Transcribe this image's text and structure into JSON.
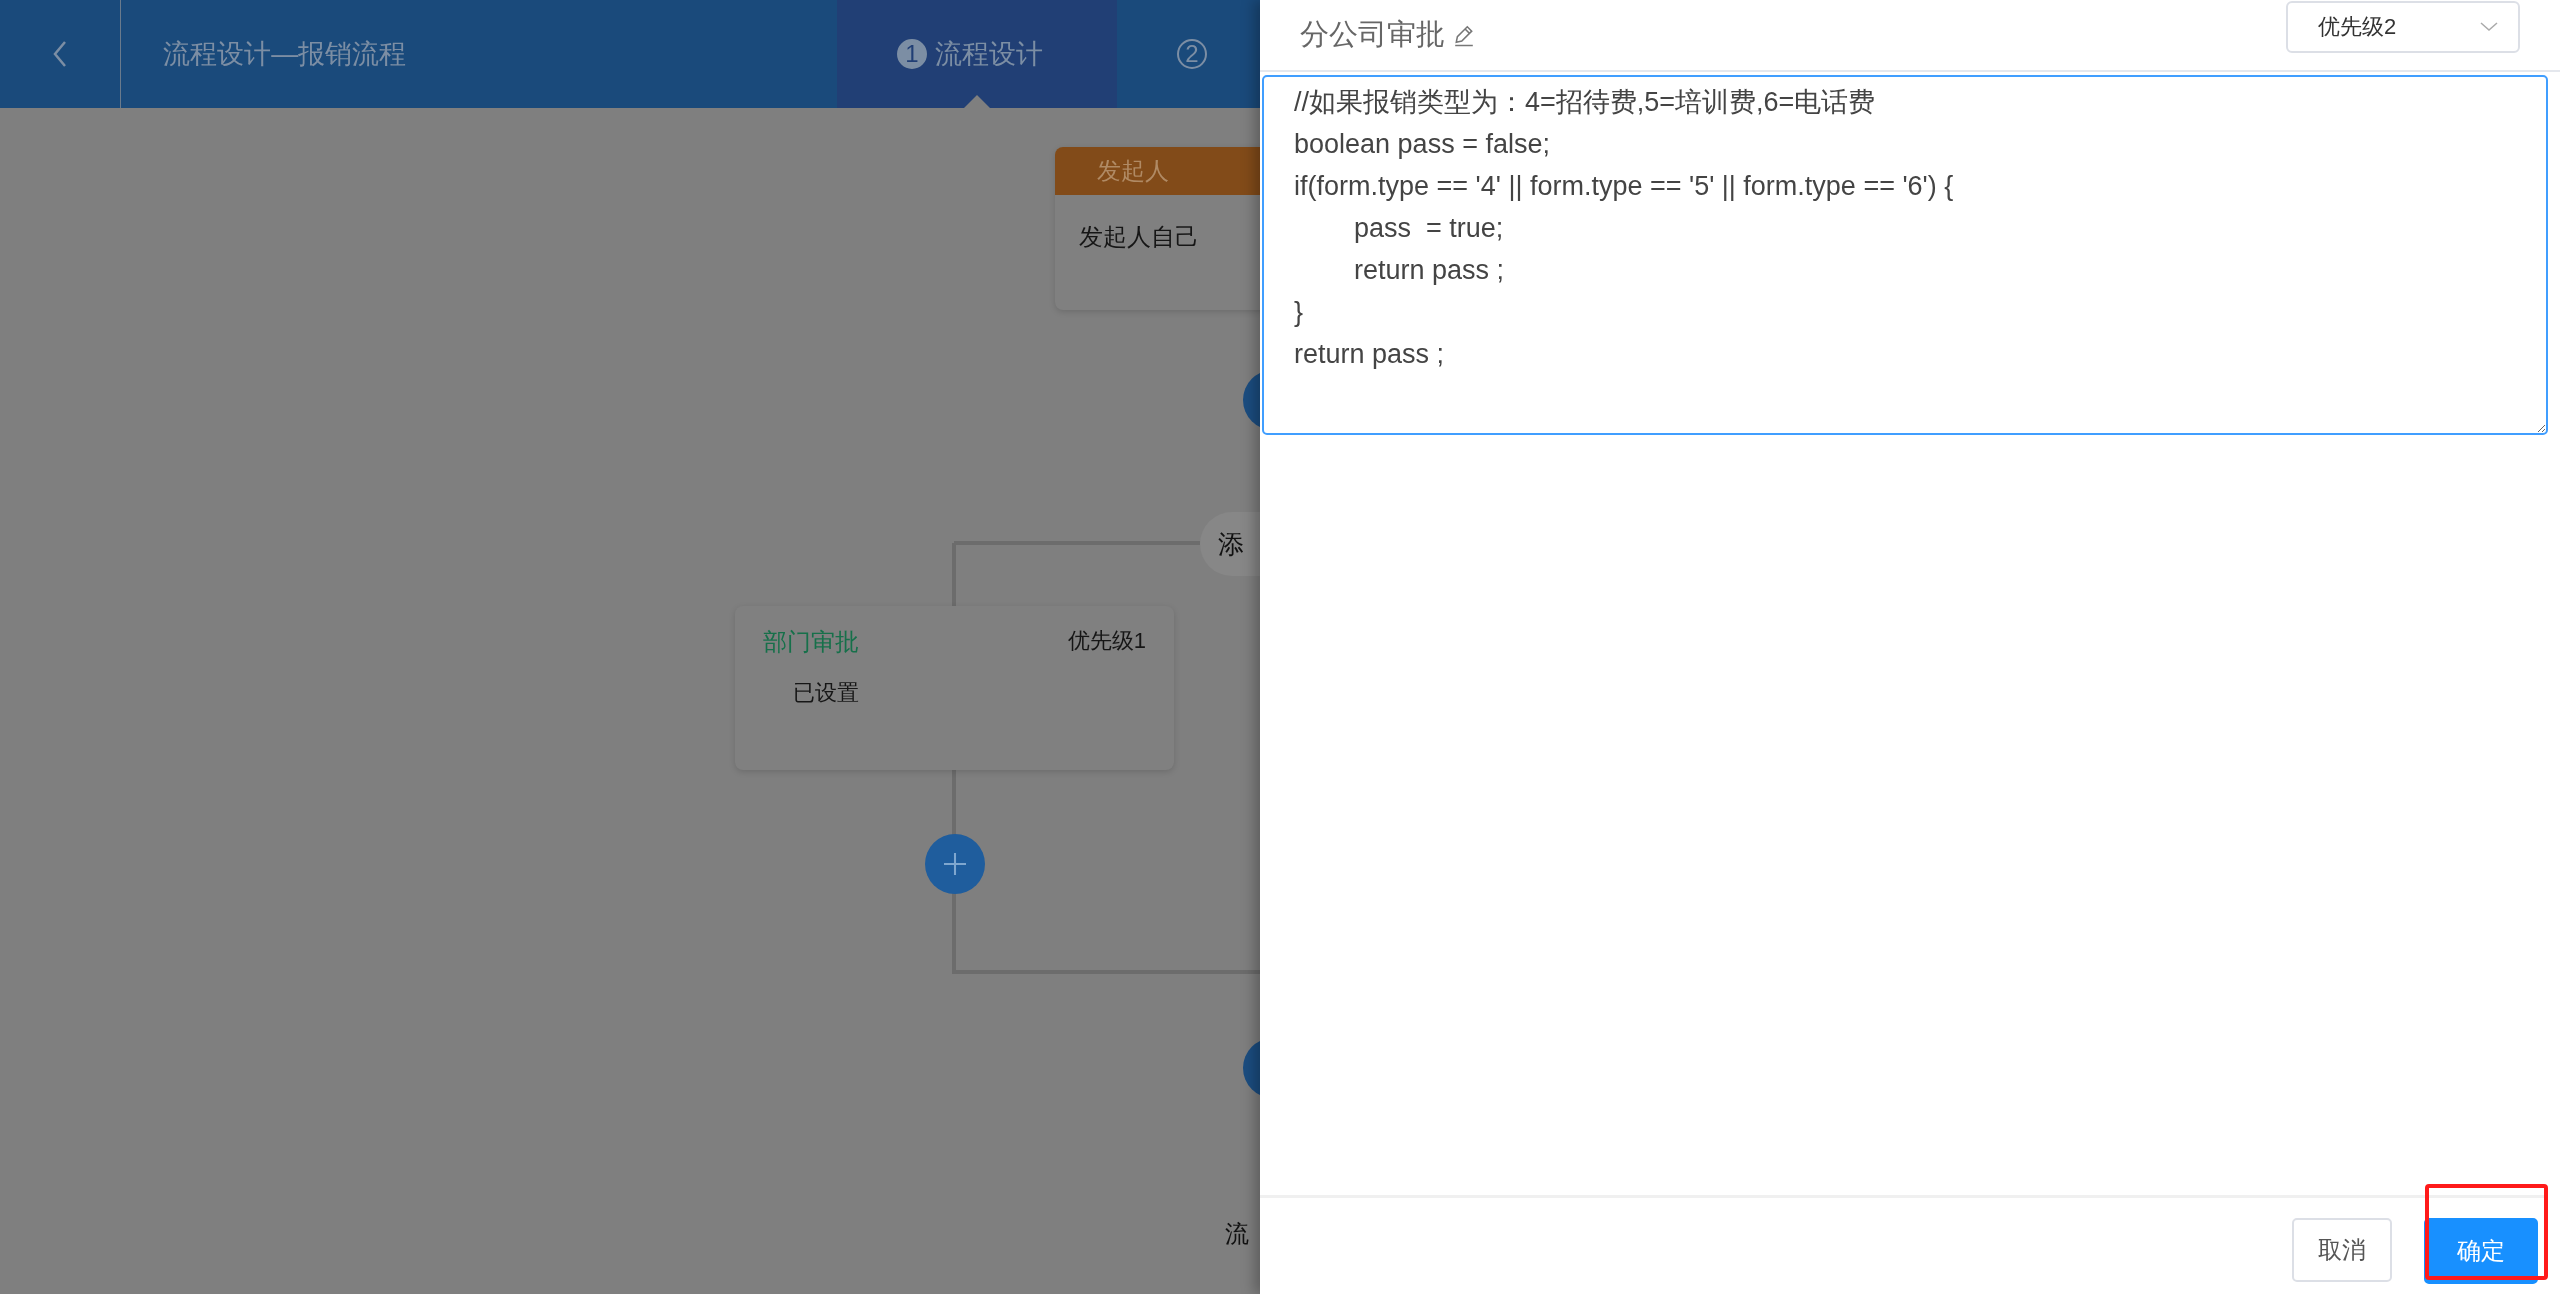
{
  "header": {
    "title": "流程设计—报销流程",
    "steps": [
      {
        "number": "1",
        "label": "流程设计",
        "selected": true
      },
      {
        "number": "2",
        "selected": false
      }
    ]
  },
  "flow": {
    "start_node": {
      "title": "发起人",
      "body": "发起人自己"
    },
    "add_condition": {
      "label": "添"
    },
    "branch_node": {
      "title": "部门审批",
      "priority": "优先级1",
      "body": "已设置"
    },
    "footer_text": "流"
  },
  "drawer": {
    "title": "分公司审批",
    "priority": {
      "value": "优先级2"
    },
    "expression": {
      "lines": [
        "//如果报销类型为：4=招待费,5=培训费,6=电话费",
        "boolean pass = false;",
        "if(form.type == '4' || form.type == '5' || form.type == '6') {",
        "\tpass  = true;",
        "\treturn pass ;",
        "}",
        "return pass ;"
      ]
    },
    "buttons": [
      {
        "label": "取消",
        "kind": "default"
      },
      {
        "label": "确定",
        "kind": "primary"
      }
    ]
  }
}
